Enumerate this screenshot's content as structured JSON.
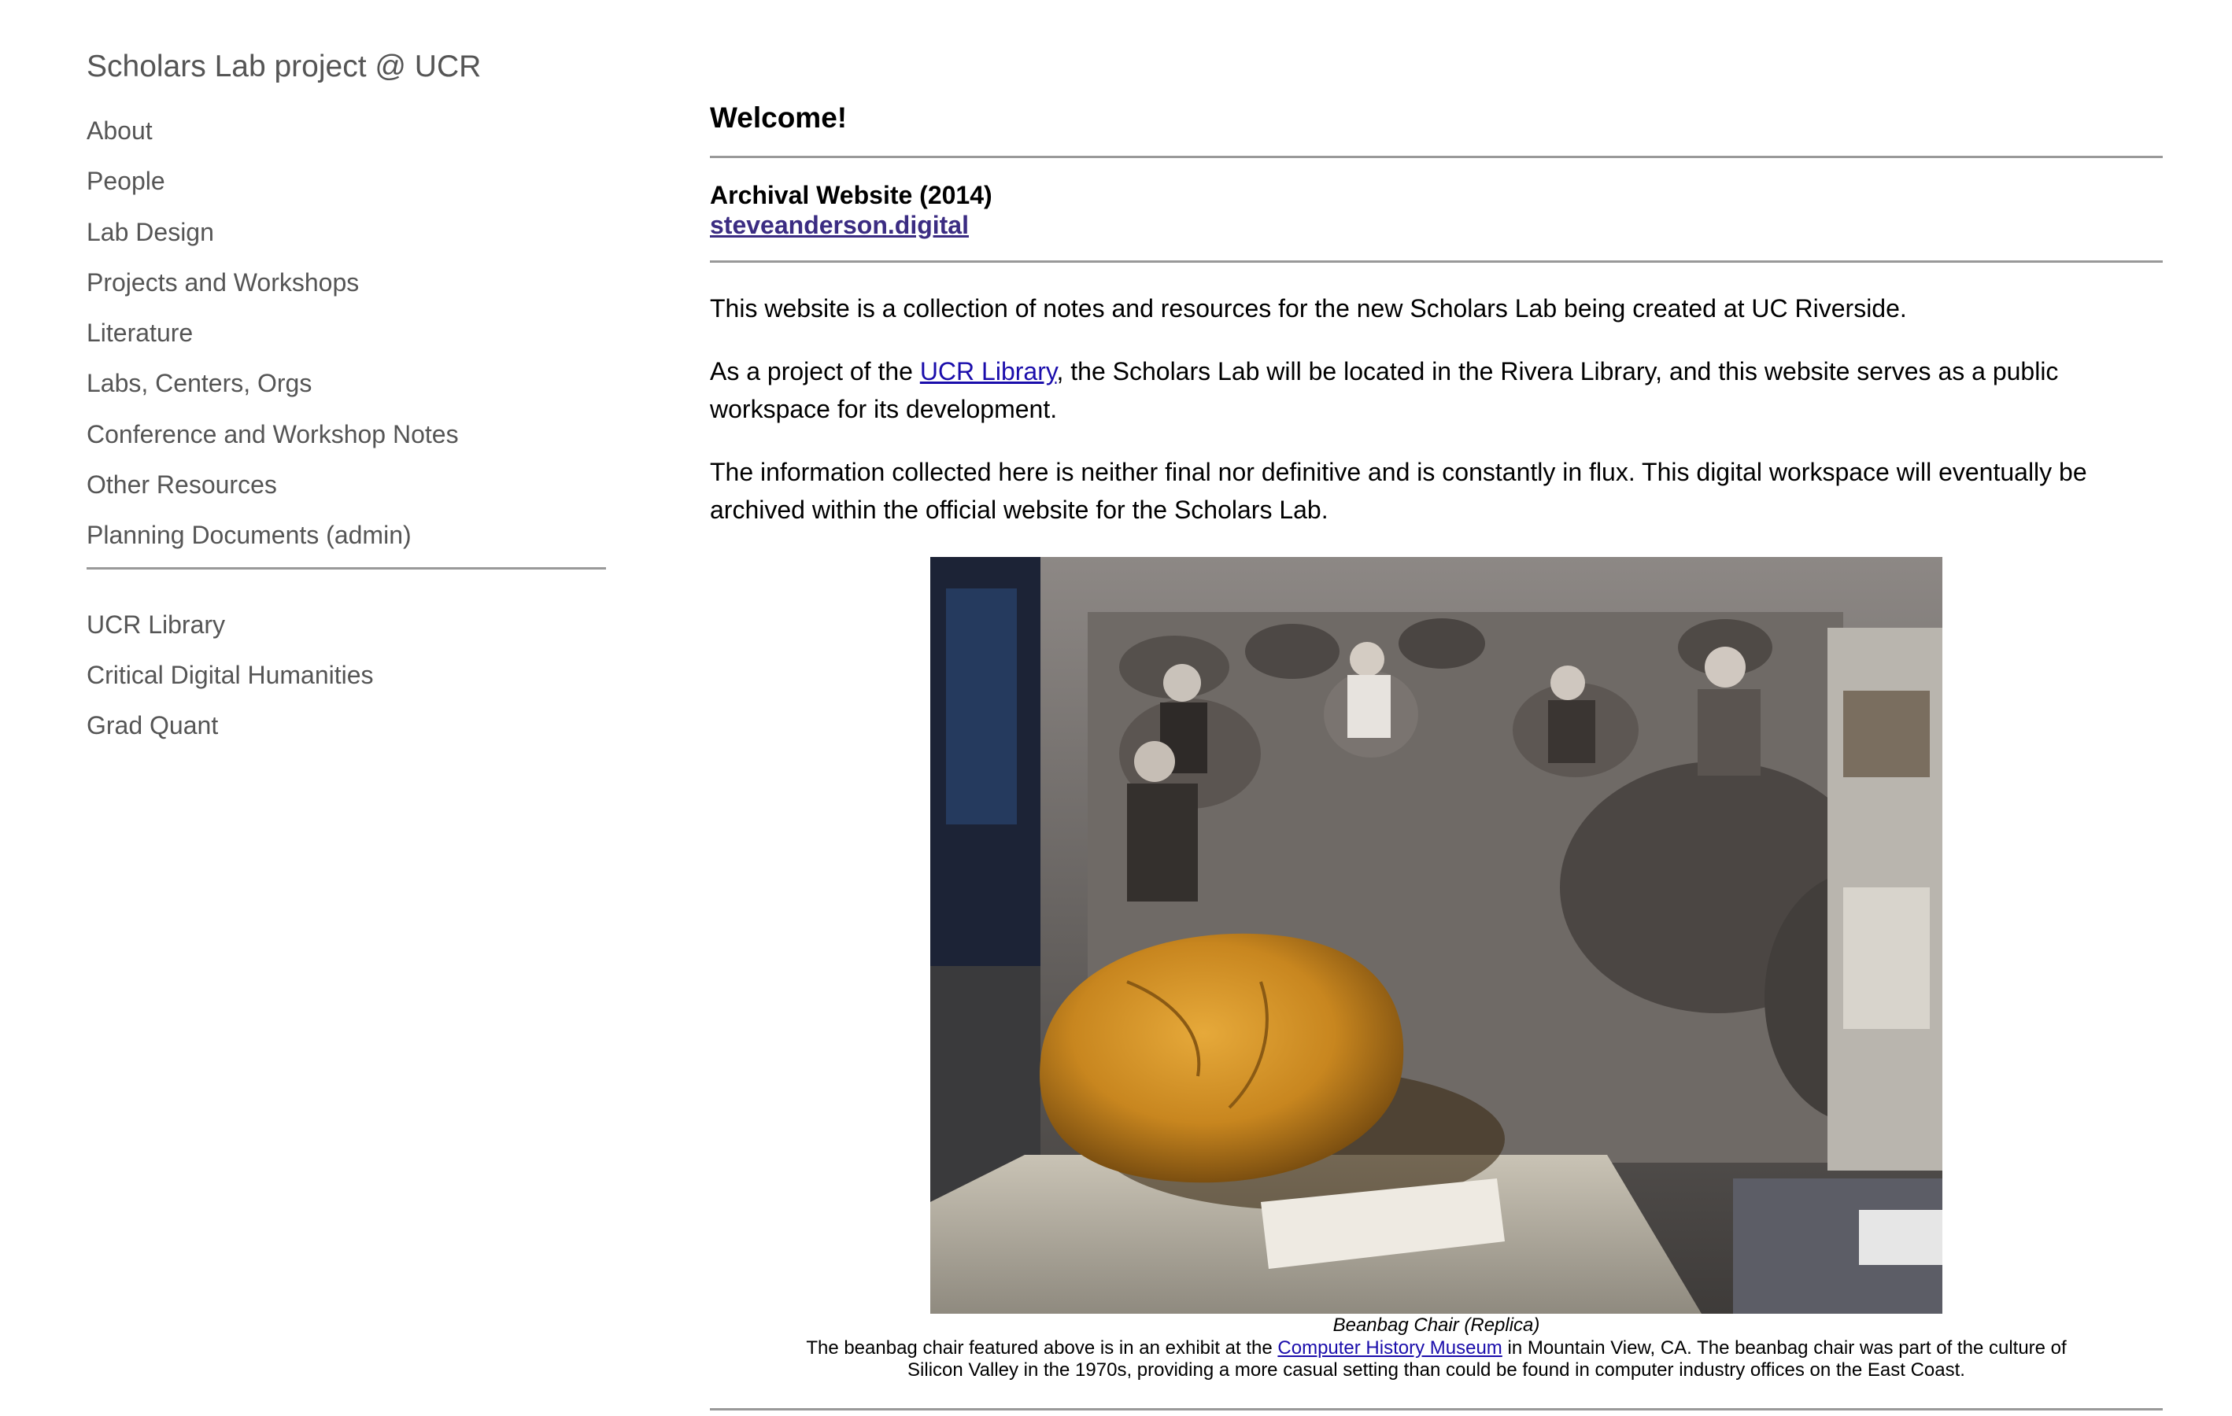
{
  "sidebar": {
    "site_title": "Scholars Lab project @ UCR",
    "nav": [
      "About",
      "People",
      "Lab Design",
      "Projects and Workshops",
      "Literature",
      "Labs, Centers, Orgs",
      "Conference and Workshop Notes",
      "Other Resources",
      "Planning Documents (admin)"
    ],
    "links": [
      "UCR Library",
      "Critical Digital Humanities",
      "Grad Quant"
    ]
  },
  "main": {
    "heading": "Welcome!",
    "archival_label": "Archival Website (2014)",
    "archival_link": "steveanderson.digital",
    "p1": "This website is a collection of notes and resources for the new Scholars Lab being created at UC Riverside.",
    "p2_before": "As a project of the ",
    "p2_link": "UCR Library",
    "p2_after": ", the Scholars Lab will be located in the Rivera Library, and this website serves as a public workspace for its development.",
    "p3": "The information collected here is neither final nor definitive and is constantly in flux. This digital workspace will eventually be archived within the official website for the Scholars Lab.",
    "figure": {
      "caption_title": "Beanbag Chair (Replica)",
      "caption_before": "The beanbag chair featured above is in an exhibit at the ",
      "caption_link": "Computer History Museum",
      "caption_after": " in Mountain View, CA. The beanbag chair was part of the culture of Silicon Valley in the 1970s, providing a more casual setting than could be found in computer industry offices on the East Coast."
    }
  }
}
